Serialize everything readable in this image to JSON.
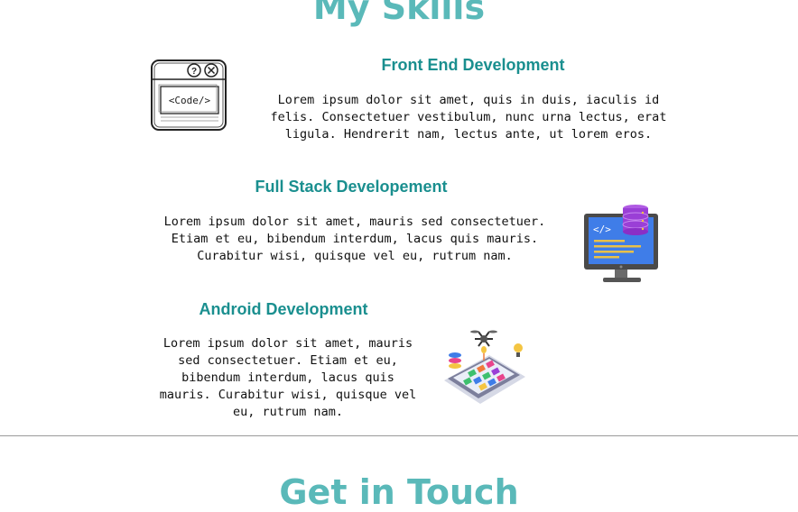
{
  "skills_section": {
    "title": "My Skills"
  },
  "skills": [
    {
      "title": "Front End Development",
      "description": "Lorem ipsum dolor sit amet, quis in duis, iaculis id felis. Consectetuer vestibulum, nunc urna lectus, erat ligula. Hendrerit nam, lectus ante, ut lorem eros.",
      "illustration": "code-window-icon",
      "illustration_text": "<Code/>"
    },
    {
      "title": "Full Stack Developement",
      "description": "Lorem ipsum dolor sit amet, mauris sed consectetuer. Etiam et eu, bibendum interdum, lacus quis mauris. Curabitur wisi, quisque vel eu, rutrum nam.",
      "illustration": "monitor-database-icon",
      "illustration_text": "</>"
    },
    {
      "title": "Android Development",
      "description": "Lorem ipsum dolor sit amet, mauris sed consectetuer. Etiam et eu, bibendum interdum, lacus quis mauris. Curabitur wisi, quisque vel eu, rutrum nam.",
      "illustration": "smartphone-apps-icon"
    }
  ],
  "contact_section": {
    "title": "Get in Touch"
  },
  "colors": {
    "section_title": "#5ab9b9",
    "skill_title": "#1a8f8f",
    "divider": "#9a9a9a"
  }
}
